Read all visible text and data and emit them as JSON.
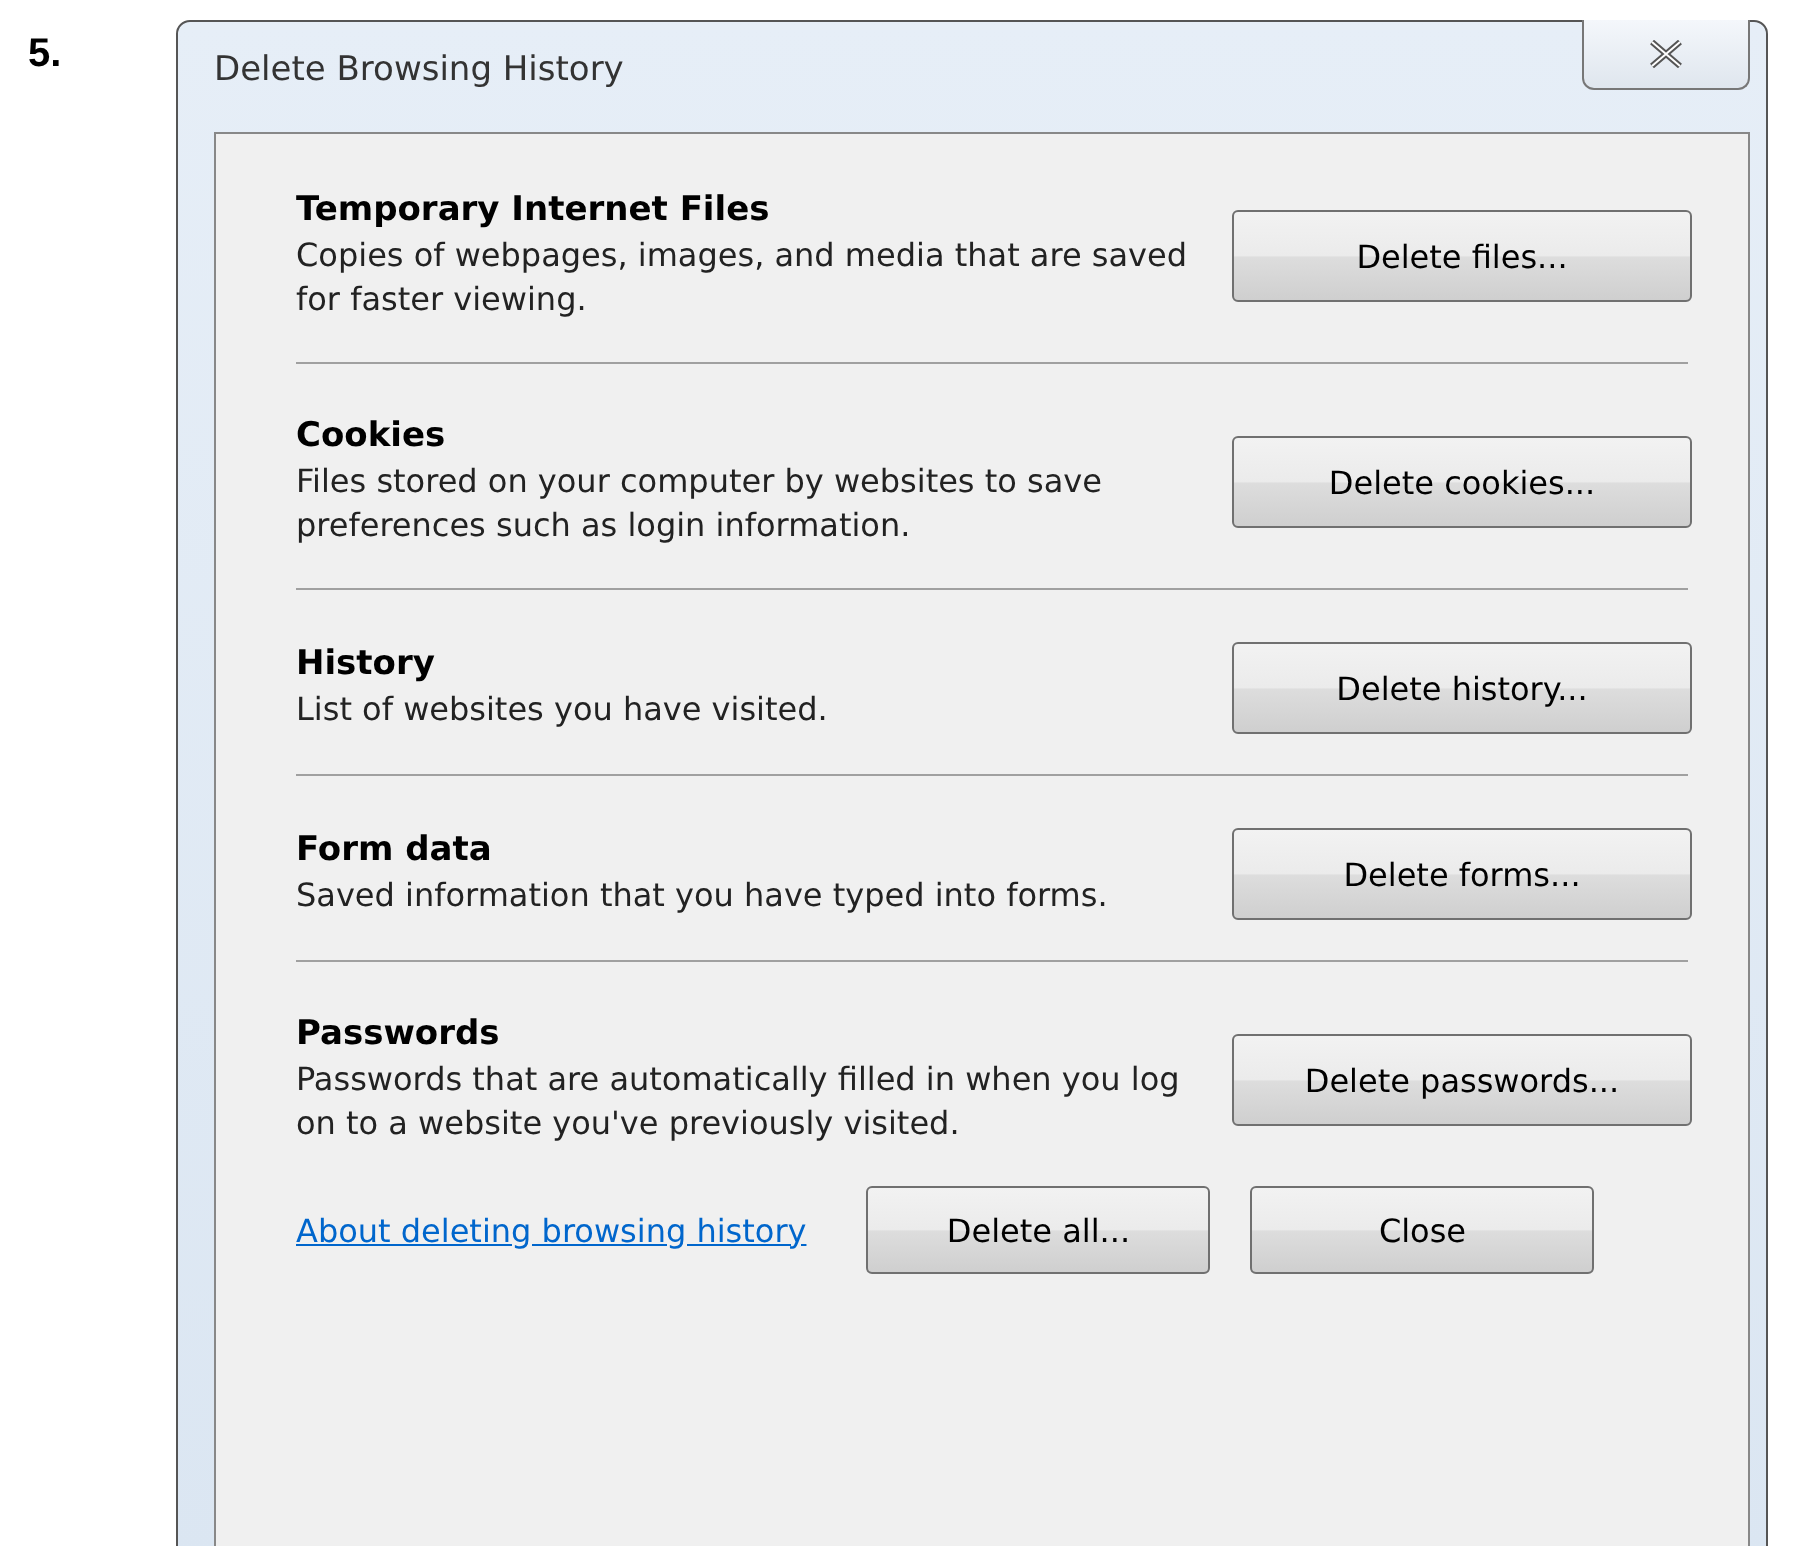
{
  "step": "5.",
  "window": {
    "title": "Delete Browsing History"
  },
  "sections": [
    {
      "title": "Temporary Internet Files",
      "description": "Copies of webpages, images, and media that are saved for faster viewing.",
      "button": "Delete files..."
    },
    {
      "title": "Cookies",
      "description": "Files stored on your computer by websites to save preferences such as login information.",
      "button": "Delete cookies..."
    },
    {
      "title": "History",
      "description": "List of websites you have visited.",
      "button": "Delete history..."
    },
    {
      "title": "Form data",
      "description": "Saved information that you have typed into forms.",
      "button": "Delete forms..."
    },
    {
      "title": "Passwords",
      "description": "Passwords that are automatically filled in when you log on to a website you've previously visited.",
      "button": "Delete passwords..."
    }
  ],
  "footer": {
    "link": "About deleting browsing history",
    "buttons": [
      "Delete all...",
      "Close"
    ]
  }
}
